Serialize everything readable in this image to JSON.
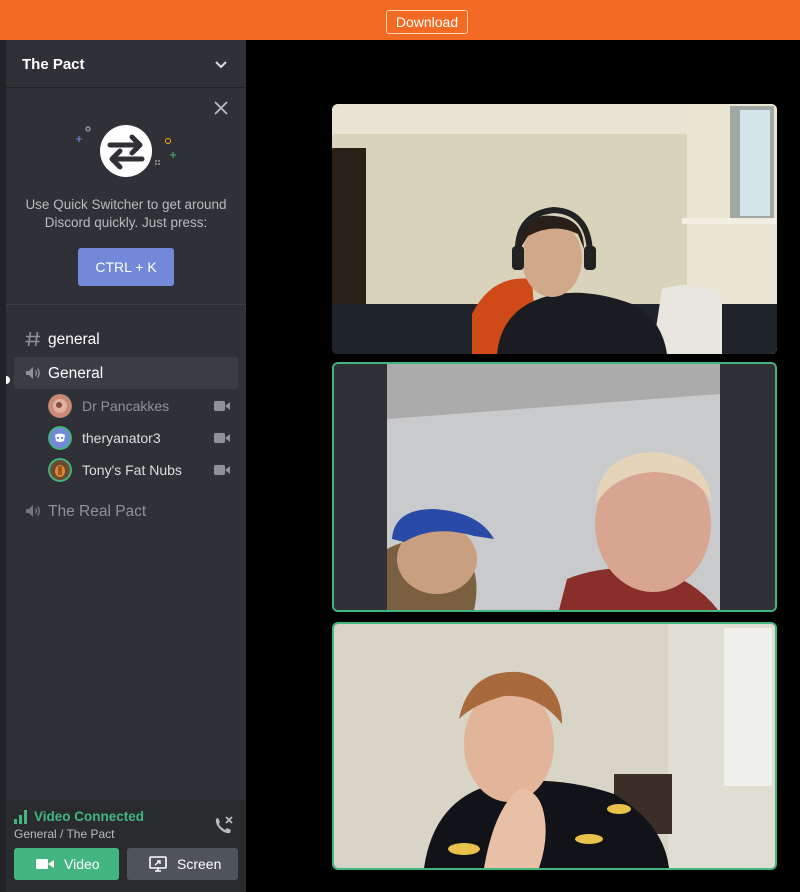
{
  "topbar": {
    "download_label": "Download",
    "bg": "#f36b23"
  },
  "server": {
    "name": "The Pact"
  },
  "quick_switcher": {
    "text": "Use Quick Switcher to get around Discord quickly. Just press:",
    "shortcut": "CTRL + K",
    "accent": "#7289da"
  },
  "channels": {
    "text_general": {
      "label": "general",
      "icon": "hash-icon"
    },
    "voice_general": {
      "label": "General",
      "icon": "speaker-icon",
      "users": [
        {
          "name": "Dr Pancakkes",
          "icon": "camera-icon"
        },
        {
          "name": "theryanator3",
          "icon": "camera-icon"
        },
        {
          "name": "Tony's Fat Nubs",
          "icon": "camera-icon"
        }
      ]
    },
    "voice_real_pact": {
      "label": "The Real Pact",
      "icon": "speaker-icon"
    }
  },
  "voice_connection": {
    "status": "Video Connected",
    "location": "General / The Pact",
    "status_color": "#43b581",
    "video_label": "Video",
    "screen_label": "Screen"
  },
  "video_tiles": [
    {
      "speaking": false
    },
    {
      "speaking": true
    },
    {
      "speaking": true
    }
  ]
}
